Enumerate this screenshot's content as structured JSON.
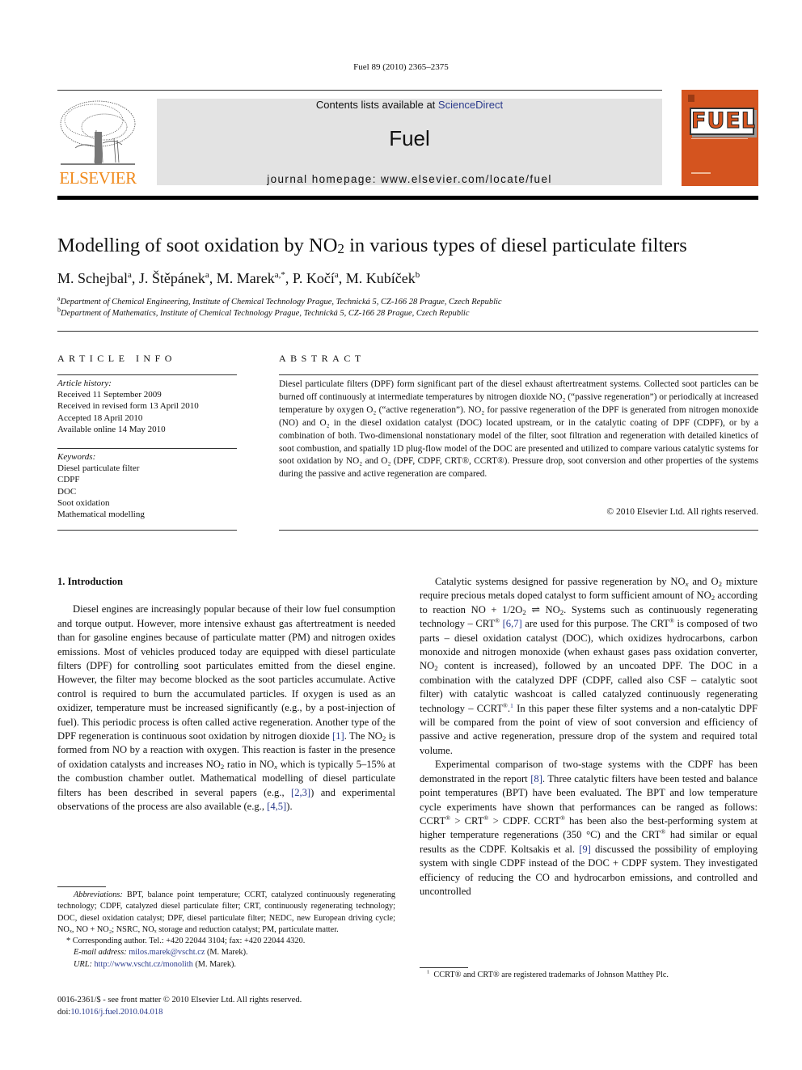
{
  "running_head": "Fuel 89 (2010) 2365–2375",
  "banner": {
    "contents_prefix": "Contents lists available at ",
    "contents_link": "ScienceDirect",
    "journal_name": "Fuel",
    "homepage": "journal homepage: www.elsevier.com/locate/fuel",
    "publisher": "ELSEVIER",
    "cover_title": "FUEL",
    "publisher_color": "#f08a1c",
    "cover_color": "#d4541f",
    "link_color": "#2a3a8c"
  },
  "article": {
    "title_pre": "Modelling of soot oxidation by NO",
    "title_sub": "2",
    "title_post": " in various types of diesel particulate filters",
    "authors": [
      {
        "name": "M. Schejbal",
        "aff": "a"
      },
      {
        "name": "J. Štěpánek",
        "aff": "a"
      },
      {
        "name": "M. Marek",
        "aff": "a,*"
      },
      {
        "name": "P. Kočí",
        "aff": "a"
      },
      {
        "name": "M. Kubíček",
        "aff": "b"
      }
    ],
    "affiliations": [
      {
        "mark": "a",
        "text": "Department of Chemical Engineering, Institute of Chemical Technology Prague, Technická 5, CZ-166 28 Prague, Czech Republic"
      },
      {
        "mark": "b",
        "text": "Department of Mathematics, Institute of Chemical Technology Prague, Technická 5, CZ-166 28 Prague, Czech Republic"
      }
    ]
  },
  "article_info": {
    "heading": "ARTICLE INFO",
    "history_label": "Article history:",
    "history": [
      "Received 11 September 2009",
      "Received in revised form 13 April 2010",
      "Accepted 18 April 2010",
      "Available online 14 May 2010"
    ],
    "keywords_label": "Keywords:",
    "keywords": [
      "Diesel particulate filter",
      "CDPF",
      "DOC",
      "Soot oxidation",
      "Mathematical modelling"
    ]
  },
  "abstract": {
    "heading": "ABSTRACT",
    "text": "Diesel particulate filters (DPF) form significant part of the diesel exhaust aftertreatment systems. Collected soot particles can be burned off continuously at intermediate temperatures by nitrogen dioxide NO₂ (“passive regeneration”) or periodically at increased temperature by oxygen O₂ (“active regeneration”). NO₂ for passive regeneration of the DPF is generated from nitrogen monoxide (NO) and O₂ in the diesel oxidation catalyst (DOC) located upstream, or in the catalytic coating of DPF (CDPF), or by a combination of both. Two-dimensional nonstationary model of the filter, soot filtration and regeneration with detailed kinetics of soot combustion, and spatially 1D plug-flow model of the DOC are presented and utilized to compare various catalytic systems for soot oxidation by NO₂ and O₂ (DPF, CDPF, CRT®, CCRT®). Pressure drop, soot conversion and other properties of the systems during the passive and active regeneration are compared.",
    "copyright": "© 2010 Elsevier Ltd. All rights reserved."
  },
  "body": {
    "section_heading": "1. Introduction",
    "left_paragraph": [
      {
        "t": "Diesel engines are increasingly popular because of their low fuel consumption and torque output. However, more intensive exhaust gas aftertreatment is needed than for gasoline engines because of particulate matter (PM) and nitrogen oxides emissions. Most of vehicles produced today are equipped with diesel particulate filters (DPF) for controlling soot particulates emitted from the diesel engine. However, the filter may become blocked as the soot particles accumulate. Active control is required to burn the accumulated particles. If oxygen is used as an oxidizer, temperature must be increased significantly (e.g., by a post-injection of fuel). This periodic process is often called active regeneration. Another type of the DPF regeneration is continuous soot oxidation by nitrogen dioxide "
      },
      {
        "ref": "[1]"
      },
      {
        "t": ". The NO"
      },
      {
        "sub": "2"
      },
      {
        "t": " is formed from NO by a reaction with oxygen. This reaction is faster in the presence of oxidation catalysts and increases NO"
      },
      {
        "sub": "2"
      },
      {
        "t": " ratio in NO"
      },
      {
        "subi": "x"
      },
      {
        "t": " which is typically 5–15% at the combustion chamber outlet. Mathematical modelling of diesel particulate filters has been described in several papers (e.g., "
      },
      {
        "ref": "[2,3]"
      },
      {
        "t": ") and experimental observations of the process are also available (e.g., "
      },
      {
        "ref": "[4,5]"
      },
      {
        "t": ")."
      }
    ],
    "right_paragraph_1": [
      {
        "t": "Catalytic systems designed for passive regeneration by NO"
      },
      {
        "subi": "x"
      },
      {
        "t": " and O"
      },
      {
        "sub": "2"
      },
      {
        "t": " mixture require precious metals doped catalyst to form sufficient amount of NO"
      },
      {
        "sub": "2"
      },
      {
        "t": " according to reaction NO + 1/2O"
      },
      {
        "sub": "2"
      },
      {
        "t": " ⇌ NO"
      },
      {
        "sub": "2"
      },
      {
        "t": ". Systems such as continuously regenerating technology – CRT"
      },
      {
        "sup": "®"
      },
      {
        "t": " "
      },
      {
        "ref": "[6,7]"
      },
      {
        "t": " are used for this purpose. The CRT"
      },
      {
        "sup": "®"
      },
      {
        "t": " is composed of two parts – diesel oxidation catalyst (DOC), which oxidizes hydrocarbons, carbon monoxide and nitrogen monoxide (when exhaust gases pass oxidation converter, NO"
      },
      {
        "sub": "2"
      },
      {
        "t": " content is increased), followed by an uncoated DPF. The DOC in a combination with the catalyzed DPF (CDPF, called also CSF – catalytic soot filter) with catalytic washcoat is called catalyzed continuously regenerating technology – CCRT"
      },
      {
        "sup": "®"
      },
      {
        "t": "."
      },
      {
        "supl": "1"
      },
      {
        "t": " In this paper these filter systems and a non-catalytic DPF will be compared from the point of view of soot conversion and efficiency of passive and active regeneration, pressure drop of the system and required total volume."
      }
    ],
    "right_paragraph_2": [
      {
        "t": "Experimental comparison of two-stage systems with the CDPF has been demonstrated in the report "
      },
      {
        "ref": "[8]"
      },
      {
        "t": ". Three catalytic filters have been tested and balance point temperatures (BPT) have been evaluated. The BPT and low temperature cycle experiments have shown that performances can be ranged as follows: CCRT"
      },
      {
        "sup": "®"
      },
      {
        "t": " > CRT"
      },
      {
        "sup": "®"
      },
      {
        "t": " > CDPF. CCRT"
      },
      {
        "sup": "®"
      },
      {
        "t": " has been also the best-performing system at higher temperature regenerations (350 °C) and the CRT"
      },
      {
        "sup": "®"
      },
      {
        "t": " had similar or equal results as the CDPF. Koltsakis et al. "
      },
      {
        "ref": "[9]"
      },
      {
        "t": " discussed the possibility of employing system with single CDPF instead of the DOC + CDPF system. They investigated efficiency of reducing the CO and hydrocarbon emissions, and controlled and uncontrolled"
      }
    ]
  },
  "footnotes": {
    "abbreviations_label": "Abbreviations:",
    "abbreviations_text": " BPT, balance point temperature; CCRT, catalyzed continuously regenerating technology; CDPF, catalyzed diesel particulate filter; CRT, continuously regenerating technology; DOC, diesel oxidation catalyst; DPF, diesel particulate filter; NEDC, new European driving cycle; NOₓ, NO + NO₂; NSRC, NOₓ storage and reduction catalyst; PM, particulate matter.",
    "corresponding": "Corresponding author. Tel.: +420 22044 3104; fax: +420 22044 4320.",
    "email_label": "E-mail address:",
    "email": "milos.marek@vscht.cz",
    "email_suffix": " (M. Marek).",
    "url_label": "URL:",
    "url": "http://www.vscht.cz/monolith",
    "url_suffix": " (M. Marek).",
    "front_matter": "0016-2361/$ - see front matter © 2010 Elsevier Ltd. All rights reserved.",
    "doi_label": "doi:",
    "doi": "10.1016/j.fuel.2010.04.018",
    "trademark_mark": "1",
    "trademark_text": "CCRT® and CRT® are registered trademarks of Johnson Matthey Plc."
  }
}
